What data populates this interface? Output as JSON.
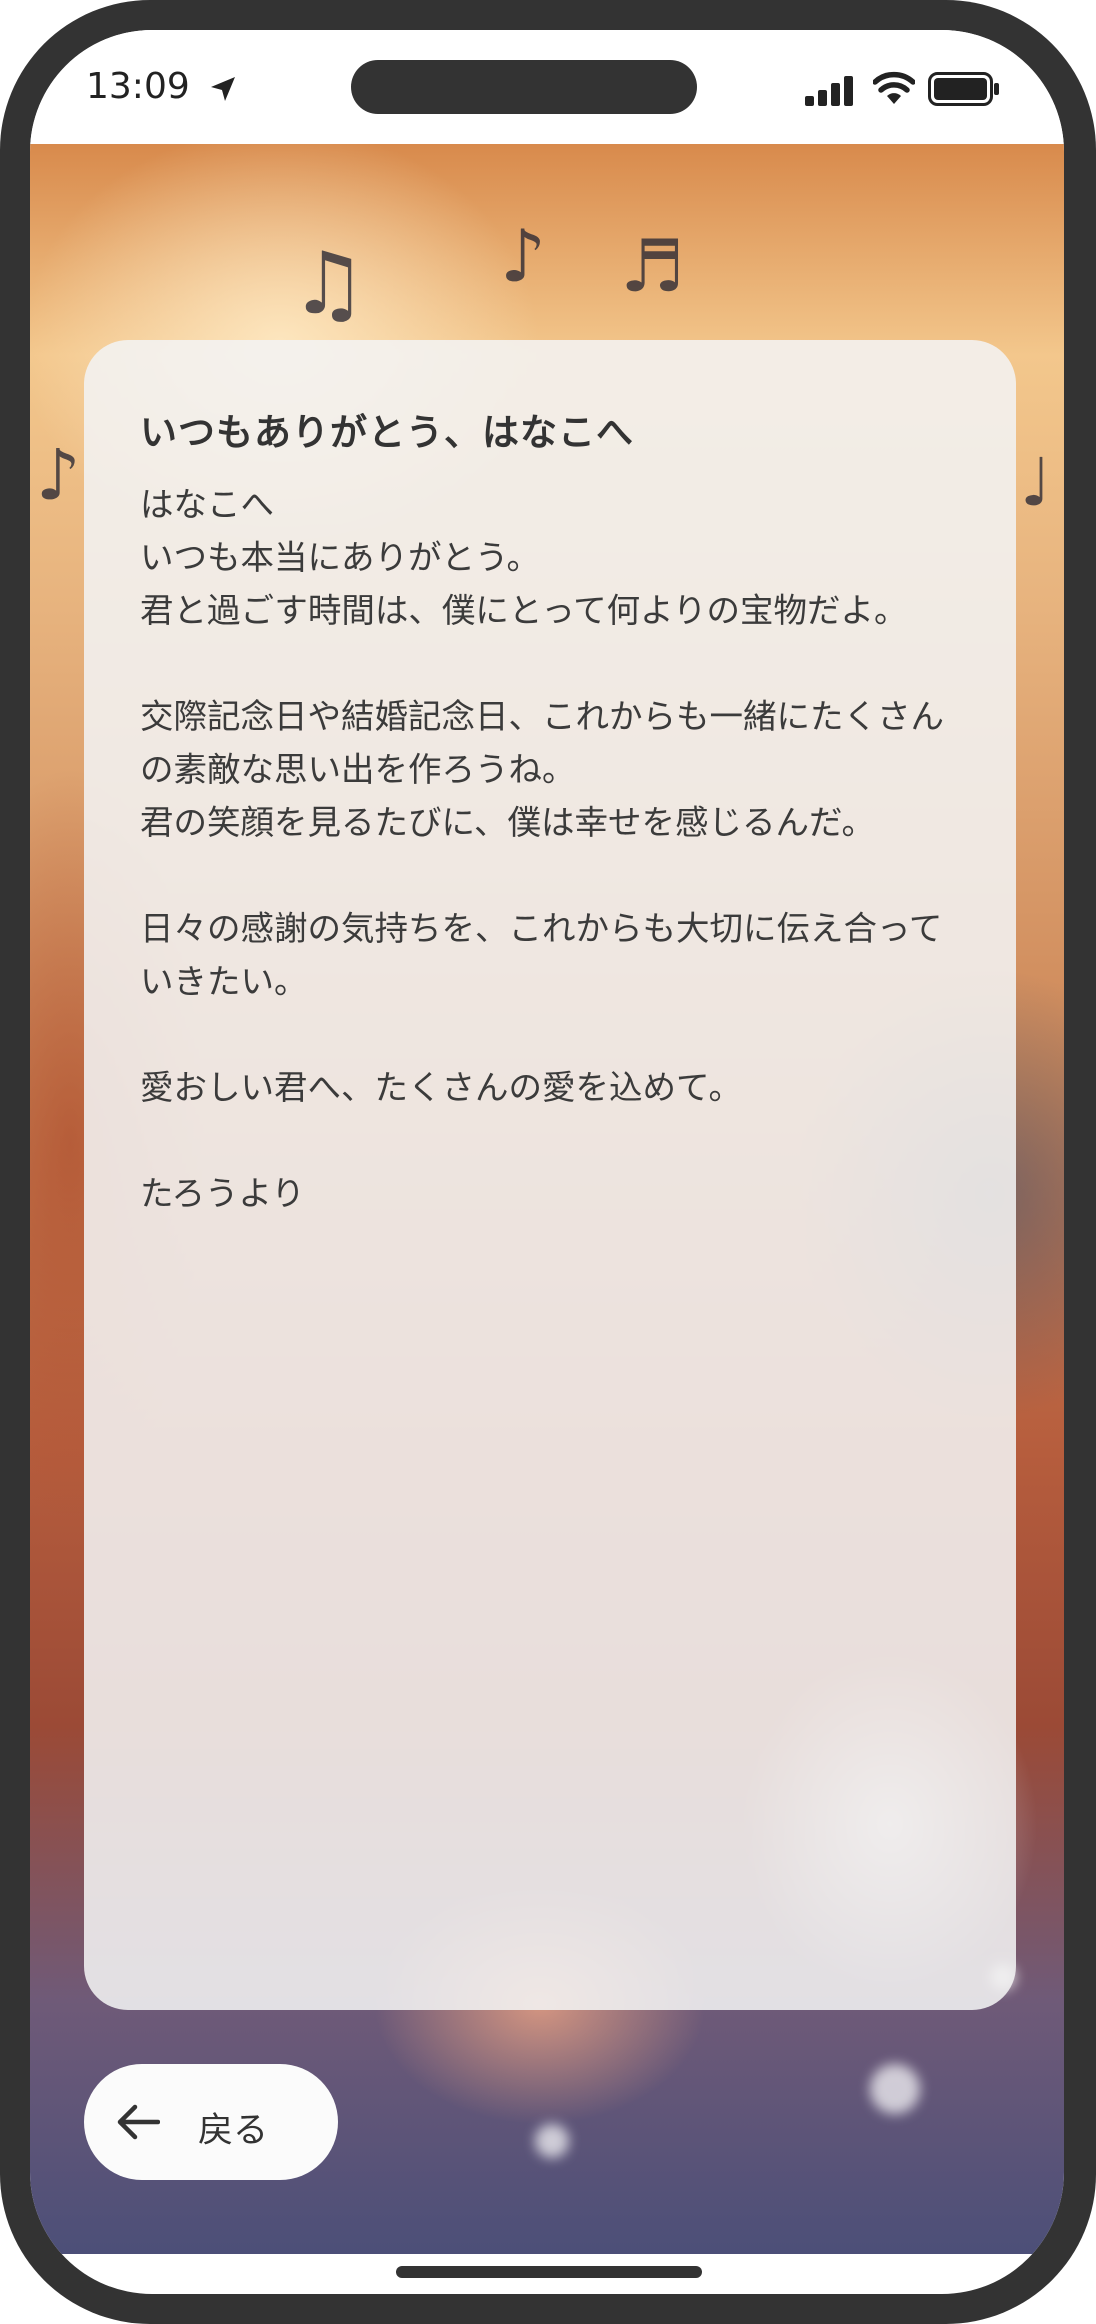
{
  "status_bar": {
    "time": "13:09",
    "icons": [
      "location-arrow-icon",
      "signal-icon",
      "wifi-icon",
      "battery-icon"
    ]
  },
  "letter": {
    "title": "いつもありがとう、はなこへ",
    "body": "はなこへ\nいつも本当にありがとう。\n君と過ごす時間は、僕にとって何よりの宝物だよ。\n\n交際記念日や結婚記念日、これからも一緒にたくさんの素敵な思い出を作ろうね。\n君の笑顔を見るたびに、僕は幸せを感じるんだ。\n\n日々の感謝の気持ちを、これからも大切に伝え合っていきたい。\n\n愛おしい君へ、たくさんの愛を込めて。\n\nたろうより"
  },
  "back_button": {
    "label": "戻る",
    "icon": "arrow-left-icon"
  },
  "colors": {
    "frame": "#333333",
    "card": "#f3f3f3",
    "text": "#333333"
  }
}
